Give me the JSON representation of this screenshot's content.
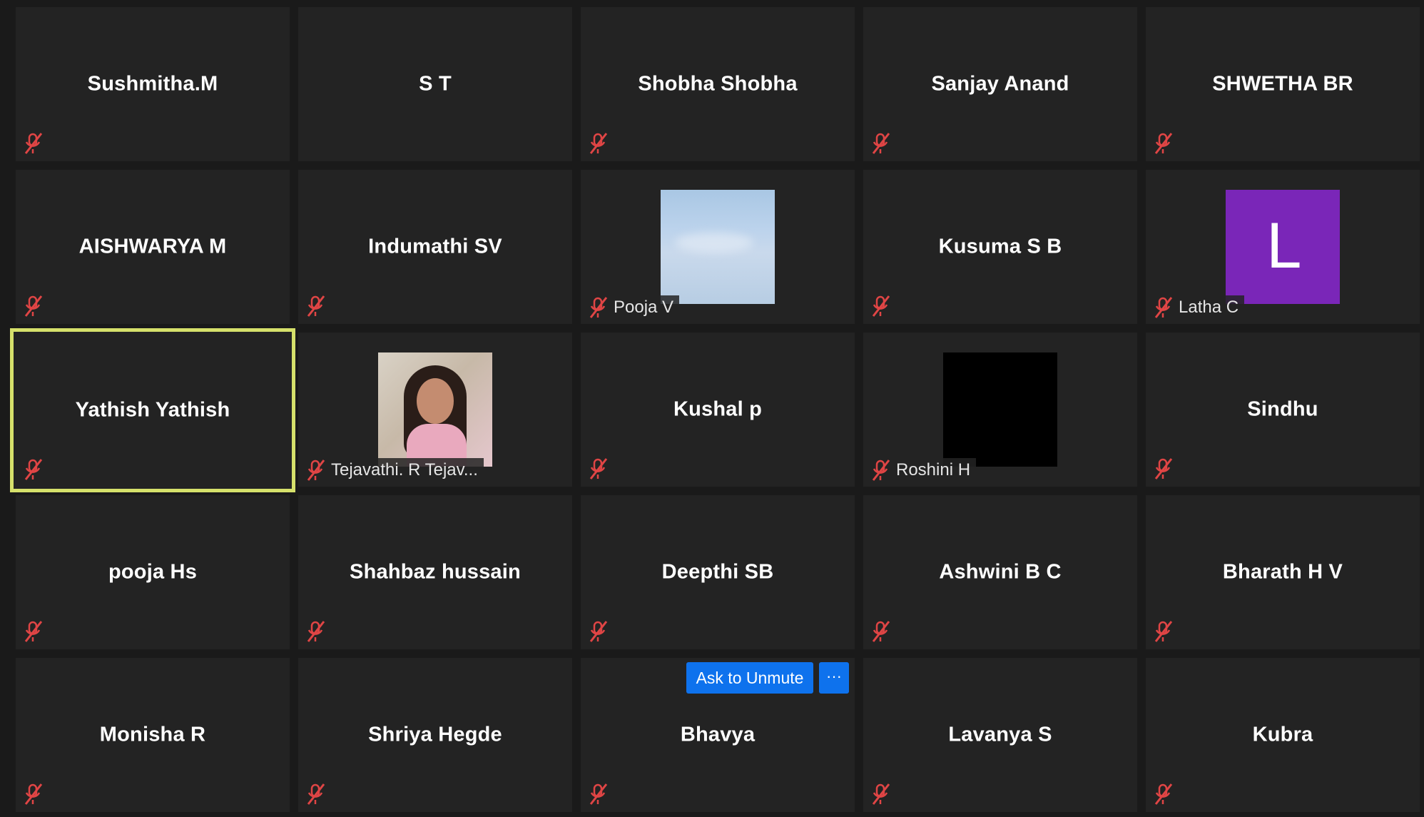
{
  "participants": [
    {
      "name": "Sushmitha.M",
      "mic": "mic-muted-icon"
    },
    {
      "name": "S T",
      "mic": "none"
    },
    {
      "name": "Shobha Shobha",
      "mic": "mic-muted-icon"
    },
    {
      "name": "Sanjay Anand",
      "mic": "mic-muted-icon"
    },
    {
      "name": "SHWETHA BR",
      "mic": "mic-muted-icon"
    },
    {
      "name": "AISHWARYA M",
      "mic": "mic-muted-icon"
    },
    {
      "name": "Indumathi SV",
      "mic": "mic-muted-icon"
    },
    {
      "name": "Pooja V",
      "mic": "mic-muted-icon",
      "thumbnail": "sky-photo"
    },
    {
      "name": "Kusuma S B",
      "mic": "mic-muted-icon"
    },
    {
      "name": "Latha C",
      "mic": "mic-muted-icon",
      "avatar_letter": "L",
      "avatar_color": "#7a26b8"
    },
    {
      "name": "Yathish Yathish",
      "mic": "mic-muted-icon",
      "active_speaker": true
    },
    {
      "name": "Tejavathi. R Tejav...",
      "mic": "mic-muted-icon",
      "thumbnail": "portrait-photo"
    },
    {
      "name": "Kushal p",
      "mic": "mic-muted-icon"
    },
    {
      "name": "Roshini H",
      "mic": "mic-muted-icon",
      "thumbnail": "black-video"
    },
    {
      "name": "Sindhu",
      "mic": "mic-muted-icon"
    },
    {
      "name": "pooja Hs",
      "mic": "mic-muted-icon"
    },
    {
      "name": "Shahbaz hussain",
      "mic": "mic-muted-icon"
    },
    {
      "name": "Deepthi SB",
      "mic": "mic-muted-icon"
    },
    {
      "name": "Ashwini B C",
      "mic": "mic-muted-icon"
    },
    {
      "name": "Bharath H V",
      "mic": "mic-muted-icon"
    },
    {
      "name": "Monisha R",
      "mic": "mic-muted-icon"
    },
    {
      "name": "Shriya Hegde",
      "mic": "mic-muted-icon"
    },
    {
      "name": "Bhavya",
      "mic": "mic-muted-icon",
      "hover_actions": true
    },
    {
      "name": "Lavanya S",
      "mic": "mic-muted-icon"
    },
    {
      "name": "Kubra",
      "mic": "mic-muted-icon"
    }
  ],
  "hover_actions": {
    "ask_to_unmute_label": "Ask to Unmute",
    "more_label": "···"
  },
  "colors": {
    "background": "#1a1a1a",
    "tile": "#232323",
    "active_border": "#d6e16b",
    "button_blue": "#0e72ed",
    "muted_red": "#e04545"
  }
}
